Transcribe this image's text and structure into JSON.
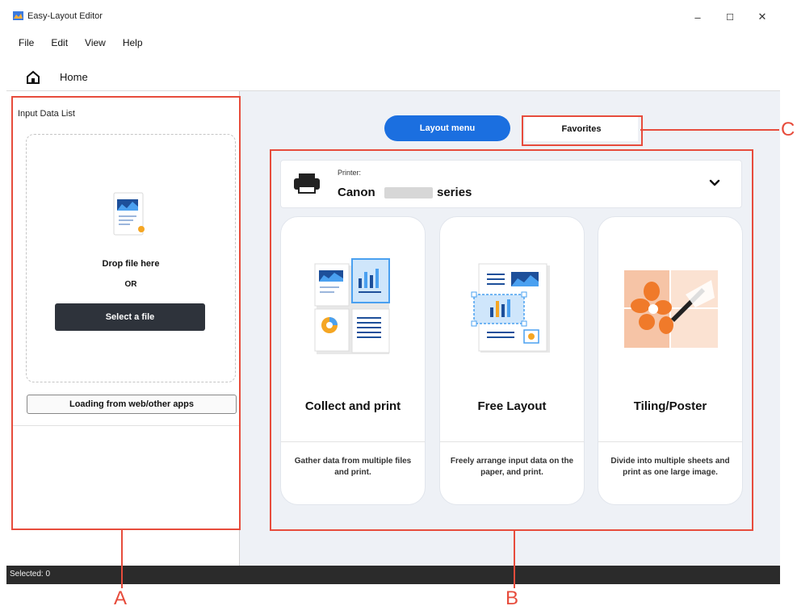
{
  "window": {
    "title": "Easy-Layout Editor",
    "controls": [
      "–",
      "☐",
      "✕"
    ]
  },
  "menu": [
    "File",
    "Edit",
    "View",
    "Help"
  ],
  "home": {
    "label": "Home"
  },
  "input_panel": {
    "title": "Input Data List",
    "drop_text": "Drop file here",
    "or_text": "OR",
    "select_button": "Select a file",
    "load_button": "Loading from web/other apps"
  },
  "tabs": {
    "layout_menu": "Layout menu",
    "favorites": "Favorites"
  },
  "printer": {
    "label": "Printer:",
    "name_prefix": "Canon",
    "name_suffix": "series"
  },
  "cards": [
    {
      "title": "Collect and print",
      "desc": "Gather data from multiple files and print."
    },
    {
      "title": "Free Layout",
      "desc": "Freely arrange input data on the paper, and print."
    },
    {
      "title": "Tiling/Poster",
      "desc": "Divide into multiple sheets and print as one large image."
    }
  ],
  "status": {
    "selected": "Selected: 0"
  },
  "callouts": {
    "a": "A",
    "b": "B",
    "c": "C"
  },
  "colors": {
    "accent": "#1b6fe0",
    "callout": "#e74c3c",
    "statusbar": "#2b2b2b"
  }
}
